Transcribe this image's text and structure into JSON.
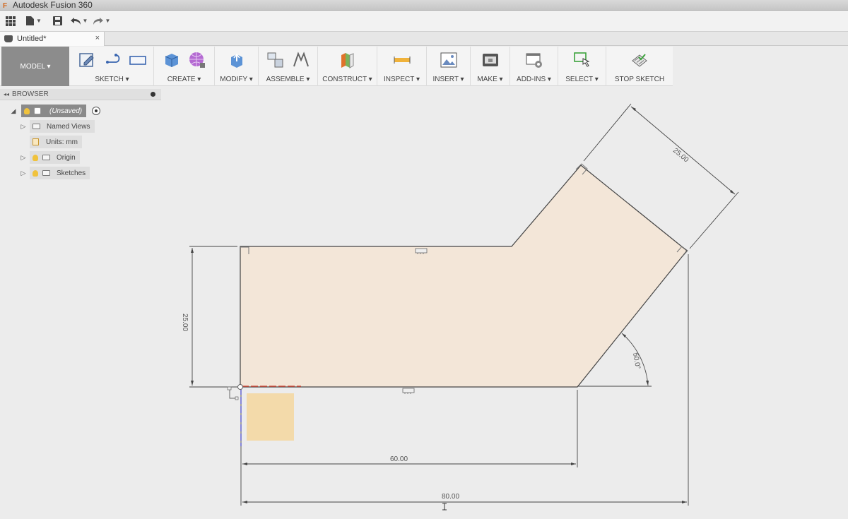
{
  "window": {
    "title": "Autodesk Fusion 360"
  },
  "document_tab": {
    "title": "Untitled*",
    "close": "×"
  },
  "workspace": {
    "label": "MODEL ▾"
  },
  "toolbar": {
    "sketch": "SKETCH ▾",
    "create": "CREATE ▾",
    "modify": "MODIFY ▾",
    "assemble": "ASSEMBLE ▾",
    "construct": "CONSTRUCT ▾",
    "inspect": "INSPECT ▾",
    "insert": "INSERT ▾",
    "make": "MAKE ▾",
    "addins": "ADD-INS ▾",
    "select": "SELECT ▾",
    "stop_sketch": "STOP SKETCH"
  },
  "browser": {
    "title": "BROWSER",
    "root": "(Unsaved)",
    "items": {
      "named_views": "Named Views",
      "units": "Units: mm",
      "origin": "Origin",
      "sketches": "Sketches"
    }
  },
  "sketch": {
    "dimensions": {
      "height_left": "25.00",
      "width_bottom": "60.00",
      "width_total": "80.00",
      "angled_width": "25.00",
      "angle": "50.0°"
    }
  },
  "colors": {
    "profile_fill": "#f3e6d8",
    "accent": "#e8a23a",
    "toolbar_bg": "#f4f4f4"
  }
}
